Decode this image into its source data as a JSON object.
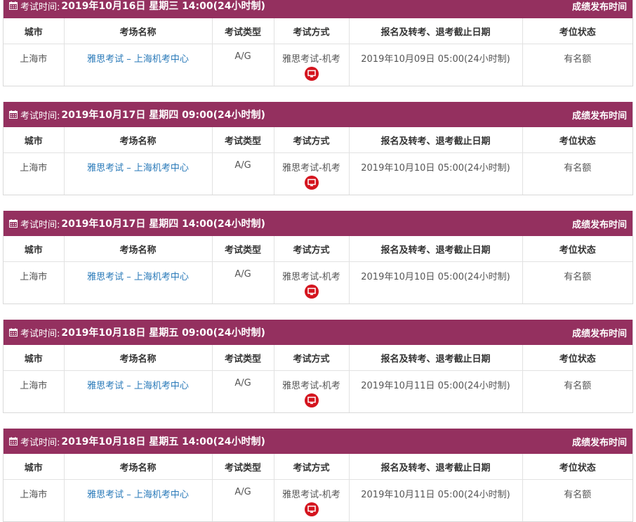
{
  "labels": {
    "header_prefix": "考试时间:",
    "header_right": "成绩发布时间"
  },
  "columns": [
    "城市",
    "考场名称",
    "考试类型",
    "考试方式",
    "报名及转考、退考截止日期",
    "考位状态"
  ],
  "sessions": [
    {
      "time": "2019年10月16日 星期三 14:00(24小时制)",
      "city": "上海市",
      "venue": "雅思考试 – 上海机考中心",
      "type": "A/G",
      "method": "雅思考试-机考",
      "deadline": "2019年10月09日 05:00(24小时制)",
      "status": "有名额"
    },
    {
      "time": "2019年10月17日 星期四 09:00(24小时制)",
      "city": "上海市",
      "venue": "雅思考试 – 上海机考中心",
      "type": "A/G",
      "method": "雅思考试-机考",
      "deadline": "2019年10月10日 05:00(24小时制)",
      "status": "有名额"
    },
    {
      "time": "2019年10月17日 星期四 14:00(24小时制)",
      "city": "上海市",
      "venue": "雅思考试 – 上海机考中心",
      "type": "A/G",
      "method": "雅思考试-机考",
      "deadline": "2019年10月10日 05:00(24小时制)",
      "status": "有名额"
    },
    {
      "time": "2019年10月18日 星期五 09:00(24小时制)",
      "city": "上海市",
      "venue": "雅思考试 – 上海机考中心",
      "type": "A/G",
      "method": "雅思考试-机考",
      "deadline": "2019年10月11日 05:00(24小时制)",
      "status": "有名额"
    },
    {
      "time": "2019年10月18日 星期五 14:00(24小时制)",
      "city": "上海市",
      "venue": "雅思考试 – 上海机考中心",
      "type": "A/G",
      "method": "雅思考试-机考",
      "deadline": "2019年10月11日 05:00(24小时制)",
      "status": "有名额"
    }
  ],
  "colors": {
    "header_bg": "#94305f",
    "venue_link": "#2a7ab9",
    "pc_icon": "#d4141e"
  },
  "icons": {
    "header": "calendar-icon",
    "method": "computer-icon"
  }
}
